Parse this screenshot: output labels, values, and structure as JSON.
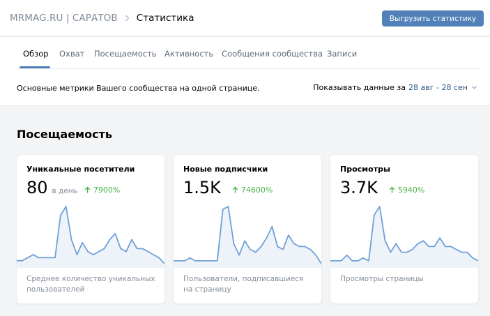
{
  "header": {
    "community": "MRMAG.RU | САРАТОВ",
    "current": "Статистика",
    "export_label": "Выгрузить статистику"
  },
  "tabs": [
    {
      "label": "Обзор",
      "active": true
    },
    {
      "label": "Охват",
      "active": false
    },
    {
      "label": "Посещаемость",
      "active": false
    },
    {
      "label": "Активность",
      "active": false
    },
    {
      "label": "Сообщения сообщества",
      "active": false
    },
    {
      "label": "Записи",
      "active": false
    }
  ],
  "overview": {
    "description": "Основные метрики Вашего сообщества на одной странице.",
    "period_label": "Показывать данные за",
    "period_value": "28 авг - 28 сен"
  },
  "section": {
    "title": "Посещаемость"
  },
  "colors": {
    "accent": "#5181b8",
    "growth": "#4bb34b",
    "line": "#6fa0d8"
  },
  "cards": [
    {
      "title": "Уникальные посетители",
      "value": "80",
      "unit": "в день",
      "growth": "7900%",
      "caption": "Среднее количество уникальных пользователей",
      "trend": [
        1,
        1,
        2,
        3,
        2,
        2,
        2,
        2,
        16,
        19,
        8,
        3,
        7,
        4,
        3,
        4,
        5,
        8,
        10,
        5,
        4,
        8,
        5,
        5,
        4,
        3,
        2,
        0
      ]
    },
    {
      "title": "Новые подписчики",
      "value": "1.5K",
      "unit": "",
      "growth": "74600%",
      "caption": "Пользователи, подписавшиеся на страницу",
      "trend": [
        1,
        1,
        1,
        2,
        1,
        1,
        1,
        1,
        1,
        19,
        20,
        7,
        3,
        8,
        5,
        4,
        6,
        9,
        13,
        6,
        5,
        10,
        7,
        6,
        6,
        5,
        3,
        0
      ]
    },
    {
      "title": "Просмотры",
      "value": "3.7K",
      "unit": "",
      "growth": "5940%",
      "caption": "Просмотры страницы",
      "trend": [
        1,
        1,
        1,
        3,
        1,
        1,
        2,
        1,
        17,
        20,
        8,
        4,
        7,
        4,
        4,
        5,
        7,
        8,
        6,
        6,
        9,
        6,
        6,
        5,
        4,
        4,
        2,
        1
      ]
    }
  ]
}
